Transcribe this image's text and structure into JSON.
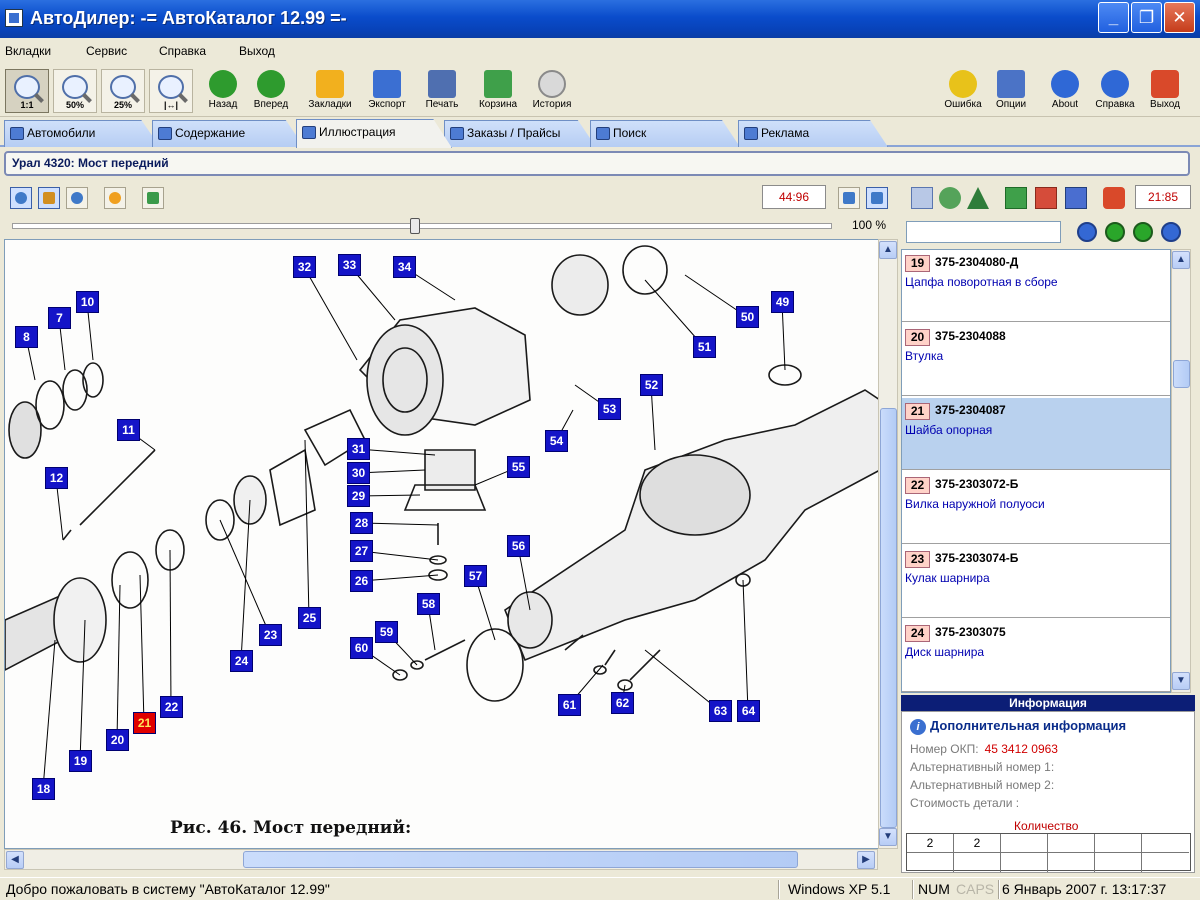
{
  "window": {
    "title": "АвтоДилер: -= АвтоКаталог 12.99 =-"
  },
  "menu": [
    "Вкладки",
    "Сервис",
    "Справка",
    "Выход"
  ],
  "toolbar": {
    "zoom": [
      "1:1",
      "50%",
      "25%",
      "|↔|"
    ],
    "left": [
      {
        "label": "Назад",
        "icon": "back-arrow-icon",
        "color": "#2e9b2e"
      },
      {
        "label": "Вперед",
        "icon": "forward-arrow-icon",
        "color": "#2e9b2e"
      },
      {
        "label": "Закладки",
        "icon": "bookmark-star-icon",
        "color": "#f2b01e"
      },
      {
        "label": "Экспорт",
        "icon": "export-icon",
        "color": "#3b6fd2"
      },
      {
        "label": "Печать",
        "icon": "printer-icon",
        "color": "#4f6fb0"
      },
      {
        "label": "Корзина",
        "icon": "cart-icon",
        "color": "#3fa04a"
      },
      {
        "label": "История",
        "icon": "history-icon",
        "color": "#8a8a8a"
      }
    ],
    "right": [
      {
        "label": "Ошибка",
        "icon": "error-face-icon",
        "color": "#e8c21a"
      },
      {
        "label": "Опции",
        "icon": "options-icon",
        "color": "#4b73c6"
      },
      {
        "label": "About",
        "icon": "info-icon",
        "color": "#2f68d6"
      },
      {
        "label": "Справка",
        "icon": "help-icon",
        "color": "#2f68d6"
      },
      {
        "label": "Выход",
        "icon": "power-icon",
        "color": "#d9492a"
      }
    ]
  },
  "tabs": [
    {
      "label": "Автомобили",
      "active": false
    },
    {
      "label": "Содержание",
      "active": false
    },
    {
      "label": "Иллюстрация",
      "active": true
    },
    {
      "label": "Заказы / Прайсы",
      "active": false
    },
    {
      "label": "Поиск",
      "active": false
    },
    {
      "label": "Реклама",
      "active": false
    }
  ],
  "breadcrumb": "Урал 4320: Мост передний",
  "viewer": {
    "counter": "44:96",
    "zoom_percent": "100 %",
    "slider_fraction": 0.49,
    "caption": "Рис. 46. Мост передний:",
    "selected_label": "21",
    "labels": [
      "32",
      "33",
      "34",
      "10",
      "8",
      "7",
      "11",
      "12",
      "51",
      "50",
      "49",
      "52",
      "53",
      "54",
      "31",
      "30",
      "29",
      "55",
      "28",
      "27",
      "26",
      "56",
      "57",
      "58",
      "59",
      "60",
      "25",
      "24",
      "23",
      "22",
      "21",
      "20",
      "19",
      "18",
      "61",
      "62",
      "63",
      "64"
    ]
  },
  "parts_panel": {
    "counter": "21:85",
    "search_value": "",
    "rows": [
      {
        "num": "19",
        "code": "375-2304080-Д",
        "name": "Цапфа поворотная в сборе",
        "selected": false
      },
      {
        "num": "20",
        "code": "375-2304088",
        "name": "Втулка",
        "selected": false
      },
      {
        "num": "21",
        "code": "375-2304087",
        "name": "Шайба опорная",
        "selected": true
      },
      {
        "num": "22",
        "code": "375-2303072-Б",
        "name": "Вилка наружной полуоси",
        "selected": false
      },
      {
        "num": "23",
        "code": "375-2303074-Б",
        "name": "Кулак шарнира",
        "selected": false
      },
      {
        "num": "24",
        "code": "375-2303075",
        "name": "Диск шарнира",
        "selected": false
      }
    ]
  },
  "info": {
    "header": "Информация",
    "title": "Дополнительная информация",
    "okp_label": "Номер ОКП:",
    "okp_value": "45 3412 0963",
    "alt1_label": "Альтернативный номер 1:",
    "alt2_label": "Альтернативный номер 2:",
    "cost_label": "Стоимость детали :",
    "qty_header": "Количество",
    "qty_values": [
      "2",
      "2"
    ]
  },
  "status": {
    "welcome": "Добро пожаловать в систему \"АвтоКаталог 12.99\"",
    "os": "Windows XP 5.1",
    "num": "NUM",
    "caps": "CAPS",
    "datetime": "6 Январь 2007 г. 13:17:37"
  }
}
